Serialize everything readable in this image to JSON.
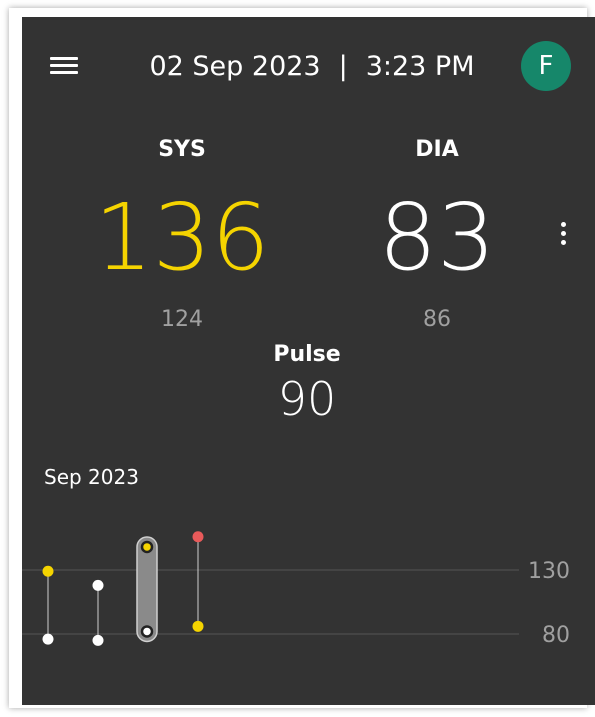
{
  "header": {
    "menu_icon": "hamburger-icon",
    "date": "02 Sep 2023",
    "separator": "|",
    "time": "3:23 PM",
    "avatar_initial": "F"
  },
  "colors": {
    "background": "#333333",
    "systolic_accent": "#f5d400",
    "avatar": "#16876a",
    "alert_point": "#e85a5a",
    "muted_text": "#a0a0a0"
  },
  "reading": {
    "sys_label": "SYS",
    "sys_value": "136",
    "sys_previous": "124",
    "dia_label": "DIA",
    "dia_value": "83",
    "dia_previous": "86",
    "pulse_label": "Pulse",
    "pulse_value": "90",
    "more_icon": "vertical-dots-icon"
  },
  "chart_data": {
    "type": "scatter",
    "title": "Sep 2023",
    "reference_lines": [
      130,
      80
    ],
    "ylim": [
      70,
      160
    ],
    "series": [
      {
        "points": [
          {
            "sys": 129,
            "dia": 76,
            "sys_color": "yellow",
            "dia_color": "white",
            "selected": false
          },
          {
            "sys": 118,
            "dia": 75,
            "sys_color": "white",
            "dia_color": "white",
            "selected": false
          },
          {
            "sys": 148,
            "dia": 82,
            "sys_color": "yellow",
            "dia_color": "white",
            "selected": true
          },
          {
            "sys": 156,
            "dia": 86,
            "sys_color": "red",
            "dia_color": "yellow",
            "selected": false
          }
        ]
      }
    ]
  }
}
